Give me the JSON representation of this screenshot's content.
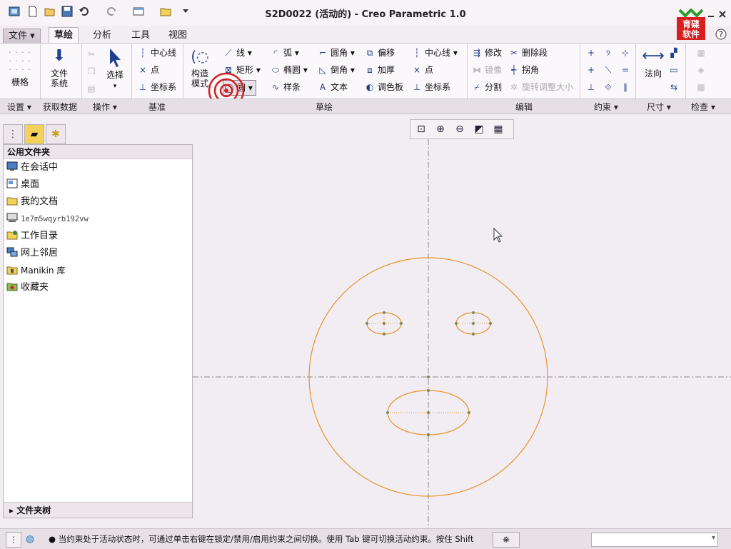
{
  "app": {
    "title": "S2D0022 (活动的) - Creo Parametric 1.0",
    "quick_access_icons": [
      "model-icon",
      "new-icon",
      "open-icon",
      "save-icon",
      "undo-icon",
      "redo-icon",
      "window-icon",
      "folder-icon",
      "customize-icon"
    ]
  },
  "tabs": [
    "文件 ▾",
    "草绘",
    "分析",
    "工具",
    "视图"
  ],
  "active_tab": "草绘",
  "ribbon": {
    "grid_label": "栅格",
    "filesystem_label": "文件\n系统",
    "select_label": "选择",
    "construct_label": "构造\n模式",
    "datum": {
      "centerline": "中心线",
      "point": "点",
      "coordsys": "坐标系"
    },
    "sketch": {
      "line": "线",
      "arc": "弧",
      "fillet": "圆角",
      "offset": "偏移",
      "rectangle": "矩形",
      "ellipse": "椭圆",
      "chamfer": "倒角",
      "thicken": "加厚",
      "circle": "圆",
      "spline": "样条",
      "text": "文本",
      "palette": "调色板",
      "centerline": "中心线",
      "point": "点",
      "coordsys": "坐标系"
    },
    "edit": {
      "modify": "修改",
      "delete_segment": "删除段",
      "mirror": "镜像",
      "corner": "拐角",
      "divide": "分割",
      "rotate_resize": "旋转调整大小"
    },
    "normal_label": "法向",
    "groups": [
      "设置 ▾",
      "获取数据",
      "操作 ▾",
      "基准",
      "草绘",
      "编辑",
      "约束 ▾",
      "尺寸 ▾",
      "检查 ▾"
    ]
  },
  "panel": {
    "header": "公用文件夹",
    "items": [
      "在会话中",
      "桌面",
      "我的文档",
      "1e7m5wqyrb192vw",
      "工作目录",
      "网上邻居",
      "Manikin 库",
      "收藏夹"
    ],
    "footer": "▸ 文件夹树"
  },
  "logo": {
    "line1": "育碟",
    "line2": "软件"
  },
  "status": {
    "message": "● 当约束处于活动状态时，可通过单击右键在锁定/禁用/启用约束之间切换。使用 Tab 键可切换活动约束。按住 Shift"
  },
  "colors": {
    "sketch_orange": "#e8932a",
    "axis": "#888888",
    "background": "#f2edf2"
  }
}
